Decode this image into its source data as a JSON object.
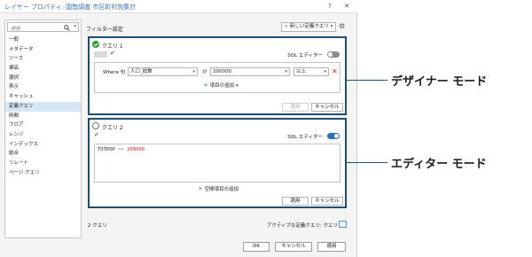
{
  "window": {
    "title": "レイヤー プロパティ: 国勢調査 市区町村別集計",
    "help_label": "?",
    "close_label": "✕"
  },
  "sidebar": {
    "search_placeholder": "検索",
    "items": [
      {
        "label": "一般"
      },
      {
        "label": "メタデータ"
      },
      {
        "label": "ソース"
      },
      {
        "label": "標高"
      },
      {
        "label": "選択"
      },
      {
        "label": "表示"
      },
      {
        "label": "キャッシュ"
      },
      {
        "label": "定義クエリ",
        "active": true
      },
      {
        "label": "時間"
      },
      {
        "label": "フロア"
      },
      {
        "label": "レンジ"
      },
      {
        "label": "インデックス"
      },
      {
        "label": "結合"
      },
      {
        "label": "リレート"
      },
      {
        "label": "ページ クエリ"
      }
    ]
  },
  "main": {
    "section_title": "フィルター設定",
    "new_query_label": "新しい定義クエリ",
    "query1": {
      "title": "クエリ 1",
      "valid_tag": "",
      "sql_editor_label": "SQL エディター",
      "sql_editor_on": false,
      "clause": {
        "where_label": "Where 句",
        "field": "人口_総数",
        "operator_label": "が",
        "value": "200000",
        "condition": "以上"
      },
      "add_item_label": "項目の追加",
      "apply_label": "適用",
      "cancel_label": "キャンセル"
    },
    "query2": {
      "title": "クエリ 2",
      "sql_editor_label": "SQL エディター",
      "sql_editor_on": true,
      "sql": {
        "field": "TOTPOP",
        "operator": ">=",
        "value": "200000"
      },
      "add_spatial_label": "空間項目の追加",
      "apply_label": "適用",
      "cancel_label": "キャンセル"
    },
    "footer": {
      "query_count": "2 クエリ",
      "active_query": "アクティブな定義クエリ: クエリ 1"
    }
  },
  "dialog_buttons": {
    "ok": "OK",
    "cancel": "キャンセル",
    "apply": "適用"
  },
  "callouts": {
    "designer_mode": "デザイナー モード",
    "editor_mode": "エディター モード"
  },
  "colors": {
    "accent_border": "#1d4f72",
    "check_green": "#2f9a3a",
    "toggle_blue": "#2f6fb5",
    "sql_value_red": "#c0282d"
  }
}
